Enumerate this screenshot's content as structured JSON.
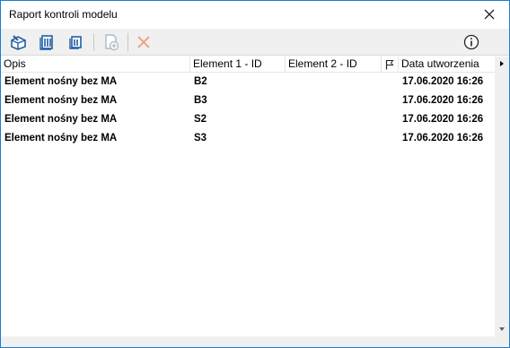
{
  "window": {
    "title": "Raport kontroli modelu"
  },
  "table": {
    "columns": [
      "Opis",
      "Element 1 - ID",
      "Element 2 - ID",
      "",
      "Data utworzenia"
    ],
    "rows": [
      {
        "opis": "Element nośny bez MA",
        "el1": "B2",
        "el2": "",
        "date": "17.06.2020 16:26"
      },
      {
        "opis": "Element nośny bez MA",
        "el1": "B3",
        "el2": "",
        "date": "17.06.2020 16:26"
      },
      {
        "opis": "Element nośny bez MA",
        "el1": "S2",
        "el2": "",
        "date": "17.06.2020 16:26"
      },
      {
        "opis": "Element nośny bez MA",
        "el1": "S3",
        "el2": "",
        "date": "17.06.2020 16:26"
      }
    ]
  },
  "colors": {
    "border": "#1a7fd4",
    "icon_blue": "#1f5fa8",
    "disabled": "#a9b8c8",
    "delete_disabled": "#f1a58a"
  }
}
